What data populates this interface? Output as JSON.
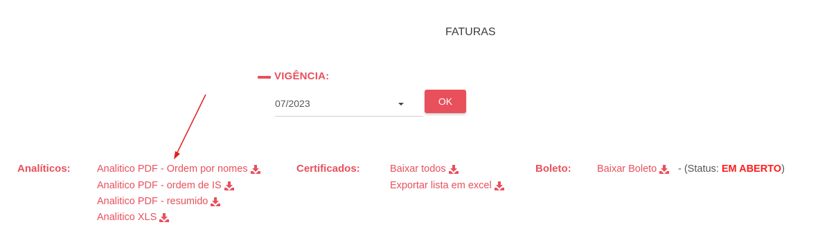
{
  "page": {
    "title": "FATURAS"
  },
  "vigencia": {
    "label": "VIGÊNCIA:",
    "selected": "07/2023",
    "ok_label": "OK"
  },
  "analiticos": {
    "label": "Analíticos:",
    "links": [
      "Analitico PDF - Ordem por nomes",
      "Analitico PDF - ordem de IS",
      "Analitico PDF - resumido",
      "Analitico XLS"
    ]
  },
  "certificados": {
    "label": "Certificados:",
    "links": [
      "Baixar todos",
      "Exportar lista em excel"
    ]
  },
  "boleto": {
    "label": "Boleto:",
    "link": "Baixar Boleto",
    "status_prefix": "- (Status:",
    "status_value": "EM ABERTO",
    "status_suffix": ")"
  },
  "colors": {
    "accent": "#e8505b",
    "status_open": "#ff1a1a"
  },
  "icons": {
    "download": "download-icon",
    "dropdown": "chevron-down-icon",
    "annotation": "annotation-arrow"
  }
}
